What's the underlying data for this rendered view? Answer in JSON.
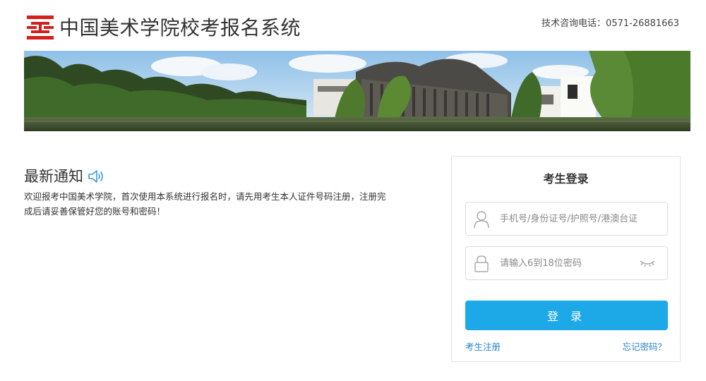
{
  "header": {
    "title": "中国美术学院校考报名系统",
    "hotline": "技术咨询电话：0571-26881663"
  },
  "notice": {
    "title": "最新通知",
    "text": "欢迎报考中国美术学院，首次使用本系统进行报名时，请先用考生本人证件号码注册，注册完成后请妥善保管好您的账号和密码！"
  },
  "login": {
    "title": "考生登录",
    "username_placeholder": "手机号/身份证号/护照号/港澳台证",
    "password_placeholder": "请输入6到18位密码",
    "submit_label": "登 录",
    "register_link": "考生注册",
    "forgot_link": "忘记密码？"
  },
  "colors": {
    "brand_red": "#d4201b",
    "accent_blue": "#1da8e8",
    "link_blue": "#2a86c8"
  },
  "icons": {
    "logo": "academy-logo-icon",
    "speaker": "speaker-icon",
    "user": "user-icon",
    "lock": "lock-icon",
    "eye": "eye-closed-icon"
  }
}
